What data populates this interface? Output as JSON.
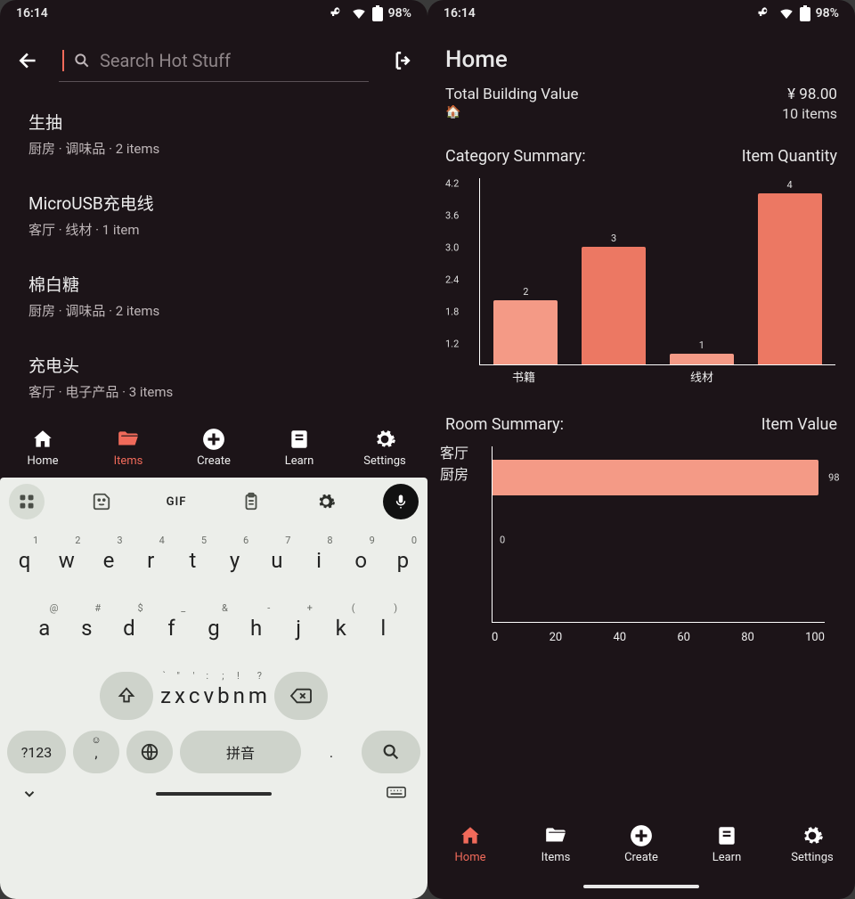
{
  "status": {
    "time": "16:14",
    "battery": "98%"
  },
  "left": {
    "search_placeholder": "Search Hot Stuff",
    "items": [
      {
        "title": "生抽",
        "sub": "厨房 · 调味品 · 2 items"
      },
      {
        "title": "MicroUSB充电线",
        "sub": "客厅 · 线材 · 1 item"
      },
      {
        "title": "棉白糖",
        "sub": "厨房 · 调味品 · 2 items"
      },
      {
        "title": "充电头",
        "sub": "客厅 · 电子产品 · 3 items"
      }
    ],
    "nav": {
      "home": "Home",
      "items": "Items",
      "create": "Create",
      "learn": "Learn",
      "settings": "Settings",
      "active": "items"
    },
    "keyboard": {
      "row1": [
        {
          "ch": "q",
          "hint": "1"
        },
        {
          "ch": "w",
          "hint": "2"
        },
        {
          "ch": "e",
          "hint": "3"
        },
        {
          "ch": "r",
          "hint": "4"
        },
        {
          "ch": "t",
          "hint": "5"
        },
        {
          "ch": "y",
          "hint": "6"
        },
        {
          "ch": "u",
          "hint": "7"
        },
        {
          "ch": "i",
          "hint": "8"
        },
        {
          "ch": "o",
          "hint": "9"
        },
        {
          "ch": "p",
          "hint": "0"
        }
      ],
      "row2": [
        {
          "ch": "a",
          "hint": "@"
        },
        {
          "ch": "s",
          "hint": "#"
        },
        {
          "ch": "d",
          "hint": "$"
        },
        {
          "ch": "f",
          "hint": "_"
        },
        {
          "ch": "g",
          "hint": "&"
        },
        {
          "ch": "h",
          "hint": "-"
        },
        {
          "ch": "j",
          "hint": "+"
        },
        {
          "ch": "k",
          "hint": "("
        },
        {
          "ch": "l",
          "hint": ")"
        }
      ],
      "row3": [
        {
          "ch": "z",
          "hint": "`"
        },
        {
          "ch": "x",
          "hint": "\""
        },
        {
          "ch": "c",
          "hint": "'"
        },
        {
          "ch": "v",
          "hint": ":"
        },
        {
          "ch": "b",
          "hint": ";"
        },
        {
          "ch": "n",
          "hint": "!"
        },
        {
          "ch": "m",
          "hint": "?"
        }
      ],
      "sym": "?123",
      "comma": ",",
      "comma_hint": "☺",
      "space": "拼音",
      "dot": ".",
      "gif": "GIF"
    }
  },
  "right": {
    "title": "Home",
    "stat_label": "Total Building Value",
    "stat_value": "¥ 98.00",
    "stat_sub_emoji": "🏠",
    "stat_sub_value": "10 items",
    "section1": "Category Summary:",
    "section1_right": "Item Quantity",
    "section2": "Room Summary:",
    "section2_right": "Item Value",
    "nav": {
      "home": "Home",
      "items": "Items",
      "create": "Create",
      "learn": "Learn",
      "settings": "Settings",
      "active": "home"
    }
  },
  "chart_data": [
    {
      "type": "bar",
      "title": "Category Summary",
      "ylabel": "Item Quantity",
      "categories": [
        "书籍",
        "",
        "线材",
        ""
      ],
      "values": [
        2,
        3,
        1,
        4
      ],
      "yticks": [
        1.2,
        1.8,
        2.4,
        3.0,
        3.6,
        4.2
      ],
      "ylim": [
        0.8,
        4.3
      ]
    },
    {
      "type": "bar",
      "orientation": "horizontal",
      "title": "Room Summary",
      "xlabel": "Item Value",
      "categories": [
        "客厅",
        "厨房"
      ],
      "values": [
        98,
        0
      ],
      "xticks": [
        0,
        20,
        40,
        60,
        80,
        100
      ],
      "xlim": [
        0,
        100
      ]
    }
  ]
}
